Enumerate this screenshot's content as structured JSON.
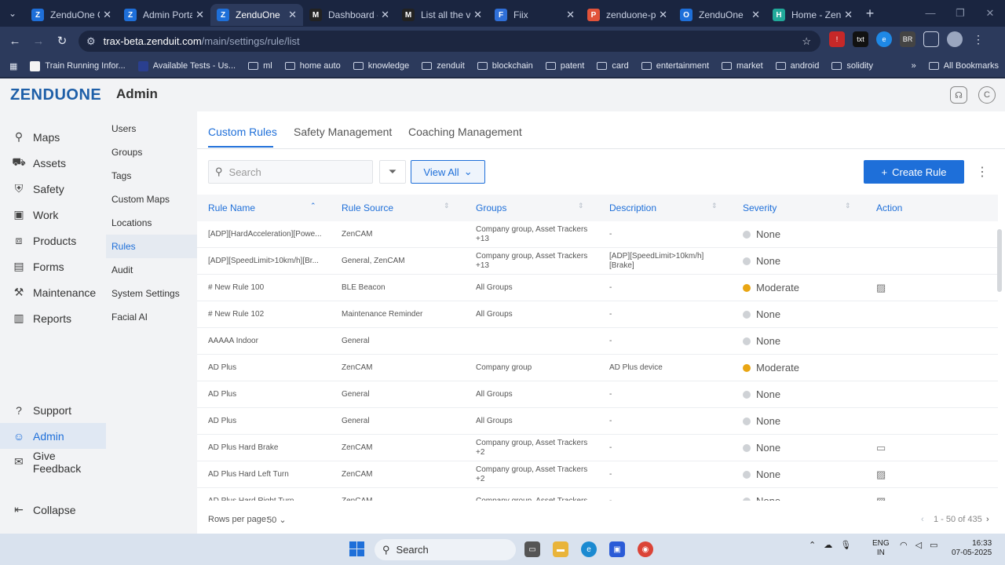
{
  "browser": {
    "tabs": [
      {
        "label": "ZenduOne C",
        "icon": "Z",
        "color": "#1e6fd9",
        "active": false
      },
      {
        "label": "Admin Portal",
        "icon": "Z",
        "color": "#1e6fd9",
        "active": false
      },
      {
        "label": "ZenduOne",
        "icon": "Z",
        "color": "#1e6fd9",
        "active": true
      },
      {
        "label": "Dashboard -",
        "icon": "M",
        "color": "#222222",
        "active": false
      },
      {
        "label": "List all the v",
        "icon": "M",
        "color": "#222222",
        "active": false
      },
      {
        "label": "Fiix",
        "icon": "F",
        "color": "#2f6fd8",
        "active": false
      },
      {
        "label": "zenduone-p",
        "icon": "P",
        "color": "#e2533a",
        "active": false
      },
      {
        "label": "ZenduOne",
        "icon": "O",
        "color": "#1e6fd9",
        "active": false
      },
      {
        "label": "Home - Zend",
        "icon": "H",
        "color": "#21a99a",
        "active": false
      }
    ],
    "url_host": "trax-beta.zenduit.com",
    "url_path": "/main/settings/rule/list",
    "bookmarks": [
      {
        "label": "Train Running Infor...",
        "type": "site"
      },
      {
        "label": "Available Tests - Us...",
        "type": "site"
      },
      {
        "label": "ml",
        "type": "folder"
      },
      {
        "label": "home auto",
        "type": "folder"
      },
      {
        "label": "knowledge",
        "type": "folder"
      },
      {
        "label": "zenduit",
        "type": "folder"
      },
      {
        "label": "blockchain",
        "type": "folder"
      },
      {
        "label": "patent",
        "type": "folder"
      },
      {
        "label": "card",
        "type": "folder"
      },
      {
        "label": "entertainment",
        "type": "folder"
      },
      {
        "label": "market",
        "type": "folder"
      },
      {
        "label": "android",
        "type": "folder"
      },
      {
        "label": "solidity",
        "type": "folder"
      }
    ],
    "more_bookmarks": "»",
    "all_bookmarks": "All Bookmarks"
  },
  "app": {
    "logo": "ZENDUONE",
    "title": "Admin",
    "avatar_initial": "C"
  },
  "sidebar": {
    "items": [
      {
        "label": "Maps",
        "icon": "map-pin-icon",
        "glyph": "⚲",
        "active": false
      },
      {
        "label": "Assets",
        "icon": "truck-icon",
        "glyph": "⛟",
        "active": false
      },
      {
        "label": "Safety",
        "icon": "shield-icon",
        "glyph": "⛨",
        "active": false
      },
      {
        "label": "Work",
        "icon": "briefcase-icon",
        "glyph": "▣",
        "active": false
      },
      {
        "label": "Products",
        "icon": "package-icon",
        "glyph": "⧈",
        "active": false
      },
      {
        "label": "Forms",
        "icon": "clipboard-icon",
        "glyph": "▤",
        "active": false
      },
      {
        "label": "Maintenance",
        "icon": "wrench-icon",
        "glyph": "⚒",
        "active": false
      },
      {
        "label": "Reports",
        "icon": "chart-icon",
        "glyph": "▥",
        "active": false
      }
    ],
    "bottom_items": [
      {
        "label": "Support",
        "icon": "help-icon",
        "glyph": "?",
        "active": false
      },
      {
        "label": "Admin",
        "icon": "user-icon",
        "glyph": "☺",
        "active": true
      },
      {
        "label": "Give Feedback",
        "icon": "feedback-icon",
        "glyph": "✉",
        "active": false
      }
    ],
    "collapse_label": "Collapse"
  },
  "subnav": {
    "items": [
      {
        "label": "Users",
        "active": false
      },
      {
        "label": "Groups",
        "active": false
      },
      {
        "label": "Tags",
        "active": false
      },
      {
        "label": "Custom Maps",
        "active": false
      },
      {
        "label": "Locations",
        "active": false
      },
      {
        "label": "Rules",
        "active": true
      },
      {
        "label": "Audit",
        "active": false
      },
      {
        "label": "System Settings",
        "active": false
      },
      {
        "label": "Facial AI",
        "active": false
      }
    ]
  },
  "main": {
    "tabs": [
      "Custom Rules",
      "Safety Management",
      "Coaching Management"
    ],
    "search_placeholder": "Search",
    "view_all_label": "View All",
    "create_label": "Create Rule",
    "columns": [
      "Rule Name",
      "Rule Source",
      "Groups",
      "Description",
      "Severity",
      "Action"
    ],
    "rows": [
      {
        "name": "[ADP][HardAcceleration][Powe...",
        "source": "ZenCAM",
        "groups": "Company group, Asset Trackers +13",
        "description": "-",
        "severity": "None",
        "action": ""
      },
      {
        "name": "[ADP][SpeedLimit>10km/h][Br...",
        "source": "General, ZenCAM",
        "groups": "Company group, Asset Trackers +13",
        "description": "[ADP][SpeedLimit>10km/h] [Brake]",
        "severity": "None",
        "action": ""
      },
      {
        "name": "# New Rule 100",
        "source": "BLE Beacon",
        "groups": "All Groups",
        "description": "-",
        "severity": "Moderate",
        "action": "image"
      },
      {
        "name": "# New Rule 102",
        "source": "Maintenance Reminder",
        "groups": "All Groups",
        "description": "-",
        "severity": "None",
        "action": ""
      },
      {
        "name": "AAAAA Indoor",
        "source": "General",
        "groups": "",
        "description": "-",
        "severity": "None",
        "action": ""
      },
      {
        "name": "AD Plus",
        "source": "ZenCAM",
        "groups": "Company group",
        "description": "AD Plus device",
        "severity": "Moderate",
        "action": ""
      },
      {
        "name": "AD Plus",
        "source": "General",
        "groups": "All Groups",
        "description": "-",
        "severity": "None",
        "action": ""
      },
      {
        "name": "AD Plus",
        "source": "General",
        "groups": "All Groups",
        "description": "-",
        "severity": "None",
        "action": ""
      },
      {
        "name": "AD Plus Hard Brake",
        "source": "ZenCAM",
        "groups": "Company group, Asset Trackers +2",
        "description": "-",
        "severity": "None",
        "action": "video"
      },
      {
        "name": "AD Plus Hard Left Turn",
        "source": "ZenCAM",
        "groups": "Company group, Asset Trackers +2",
        "description": "-",
        "severity": "None",
        "action": "image"
      },
      {
        "name": "AD Plus Hard Right Turn",
        "source": "ZenCAM",
        "groups": "Company group, Asset Trackers",
        "description": "-",
        "severity": "None",
        "action": "image"
      }
    ],
    "rows_per_page_label": "Rows per page:",
    "rows_per_page_value": "50",
    "pagination": "1 - 50 of 435"
  },
  "taskbar": {
    "search_label": "Search",
    "lang": "ENG",
    "region": "IN",
    "time": "16:33",
    "date": "07-05-2025"
  }
}
